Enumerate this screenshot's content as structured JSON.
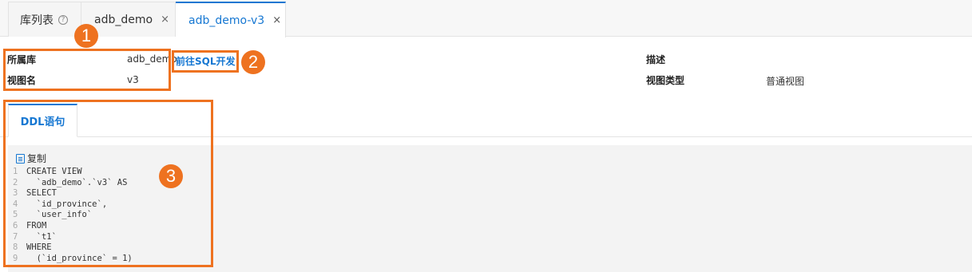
{
  "tabs": [
    {
      "label": "库列表",
      "help": "?"
    },
    {
      "label": "adb_demo",
      "close": "×"
    },
    {
      "label": "adb_demo-v3",
      "close": "×"
    }
  ],
  "info": {
    "db_label": "所属库",
    "db_value": "adb_demo",
    "view_label": "视图名",
    "view_value": "v3",
    "goto_link": "前往SQL开发",
    "desc_label": "描述",
    "view_type_label": "视图类型",
    "view_type_value": "普通视图"
  },
  "ddl": {
    "tab_label": "DDL语句",
    "copy_label": "复制",
    "lines": [
      {
        "n": "1",
        "text": "CREATE VIEW"
      },
      {
        "n": "2",
        "text": "  `adb_demo`.`v3` AS"
      },
      {
        "n": "3",
        "text": "SELECT"
      },
      {
        "n": "4",
        "text": "  `id_province`,"
      },
      {
        "n": "5",
        "text": "  `user_info`"
      },
      {
        "n": "6",
        "text": "FROM"
      },
      {
        "n": "7",
        "text": "  `t1`"
      },
      {
        "n": "8",
        "text": "WHERE"
      },
      {
        "n": "9",
        "text": "  (`id_province` = 1)"
      }
    ]
  },
  "annotations": [
    "1",
    "2",
    "3"
  ],
  "colors": {
    "accent": "#1677d2",
    "annotation": "#ee7220"
  }
}
